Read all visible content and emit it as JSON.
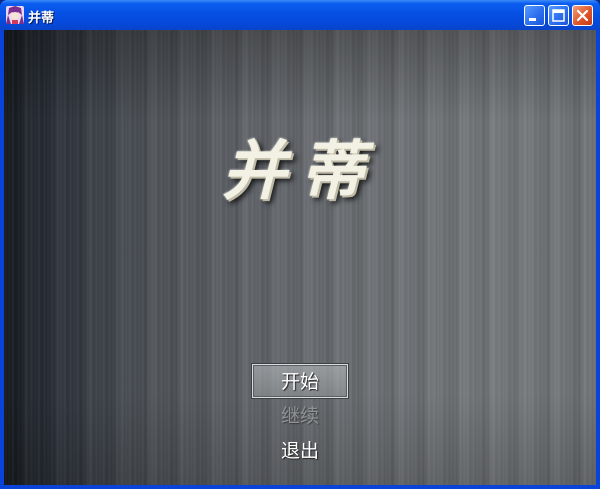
{
  "window": {
    "title": "并蒂",
    "icon": "anime-character-app-icon",
    "buttons": {
      "minimize": "minimize-icon",
      "maximize": "maximize-icon",
      "close": "close-icon"
    }
  },
  "game": {
    "title": "并蒂"
  },
  "menu": {
    "items": [
      {
        "label": "开始",
        "state": "selected"
      },
      {
        "label": "继续",
        "state": "disabled"
      },
      {
        "label": "退出",
        "state": "normal"
      }
    ]
  },
  "colors": {
    "titlebar_blue": "#0650e4",
    "close_red": "#e0562a",
    "title_text": "#f3f1e4",
    "menu_disabled": "#8f9396"
  }
}
